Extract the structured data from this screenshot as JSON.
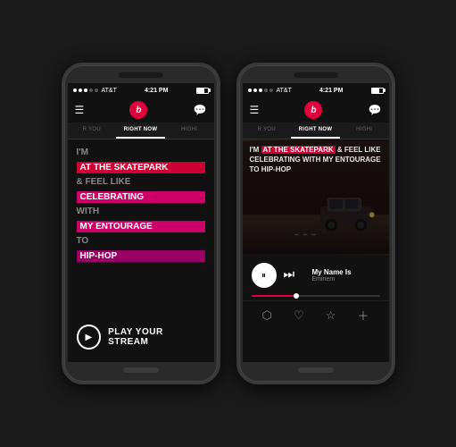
{
  "app": {
    "title": "Beats Music"
  },
  "phones": [
    {
      "id": "phone-left",
      "status": {
        "carrier": "AT&T",
        "time": "4:21 PM"
      },
      "tabs": [
        {
          "label": "R YOU",
          "active": false
        },
        {
          "label": "RIGHT NOW",
          "active": true
        },
        {
          "label": "HIGHI",
          "active": false
        }
      ],
      "lyrics": {
        "line1": "I'M",
        "highlight1": "AT THE SKATEPARK",
        "line2": "& FEEL LIKE",
        "highlight2": "CELEBRATING",
        "line3": "WITH",
        "highlight3": "MY ENTOURAGE",
        "line4": "TO",
        "highlight4": "HIP-HOP"
      },
      "play_btn_label": "PLAY YOUR STREAM"
    },
    {
      "id": "phone-right",
      "status": {
        "carrier": "AT&T",
        "time": "4:21 PM"
      },
      "tabs": [
        {
          "label": "R YOU",
          "active": false
        },
        {
          "label": "RIGHT NOW",
          "active": true
        },
        {
          "label": "HIGHI",
          "active": false
        }
      ],
      "album_lyrics": "I'M AT THE SKATEPARK & FEEL LIKE CELEBRATING WITH MY ENTOURAGE TO HIP-HOP",
      "track": {
        "title": "My Name Is",
        "artist": "Eminem"
      },
      "progress_percent": 35,
      "actions": [
        "share",
        "heart",
        "star",
        "plus"
      ]
    }
  ]
}
